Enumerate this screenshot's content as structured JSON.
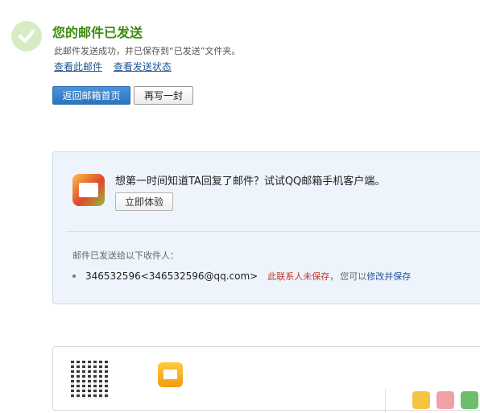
{
  "status": {
    "title": "您的邮件已发送",
    "description": "此邮件发送成功，并已保存到“已发送”文件夹。",
    "view_mail_link": "查看此邮件",
    "view_status_link": "查看发送状态"
  },
  "actions": {
    "back_button": "返回邮箱首页",
    "write_button": "再写一封"
  },
  "promo": {
    "text": "想第一时间知道TA回复了邮件？试试QQ邮箱手机客户端。",
    "try_button": "立即体验"
  },
  "recipients": {
    "label": "邮件已发送给以下收件人：",
    "items": [
      {
        "address": "346532596<346532596@qq.com>",
        "warning": "此联系人未保存",
        "separator": "，",
        "note": "您可以",
        "edit_link": "修改并保存"
      }
    ]
  },
  "colors": {
    "success_green": "#3d8b0f",
    "link_blue": "#1e5494",
    "primary_button": "#2d74c0",
    "warning_red": "#c0392b",
    "panel_bg": "#eef4fb"
  },
  "icons": {
    "success": "checkmark-circle-icon",
    "mobile_app": "qq-mail-app-icon",
    "qr": "qr-code"
  }
}
